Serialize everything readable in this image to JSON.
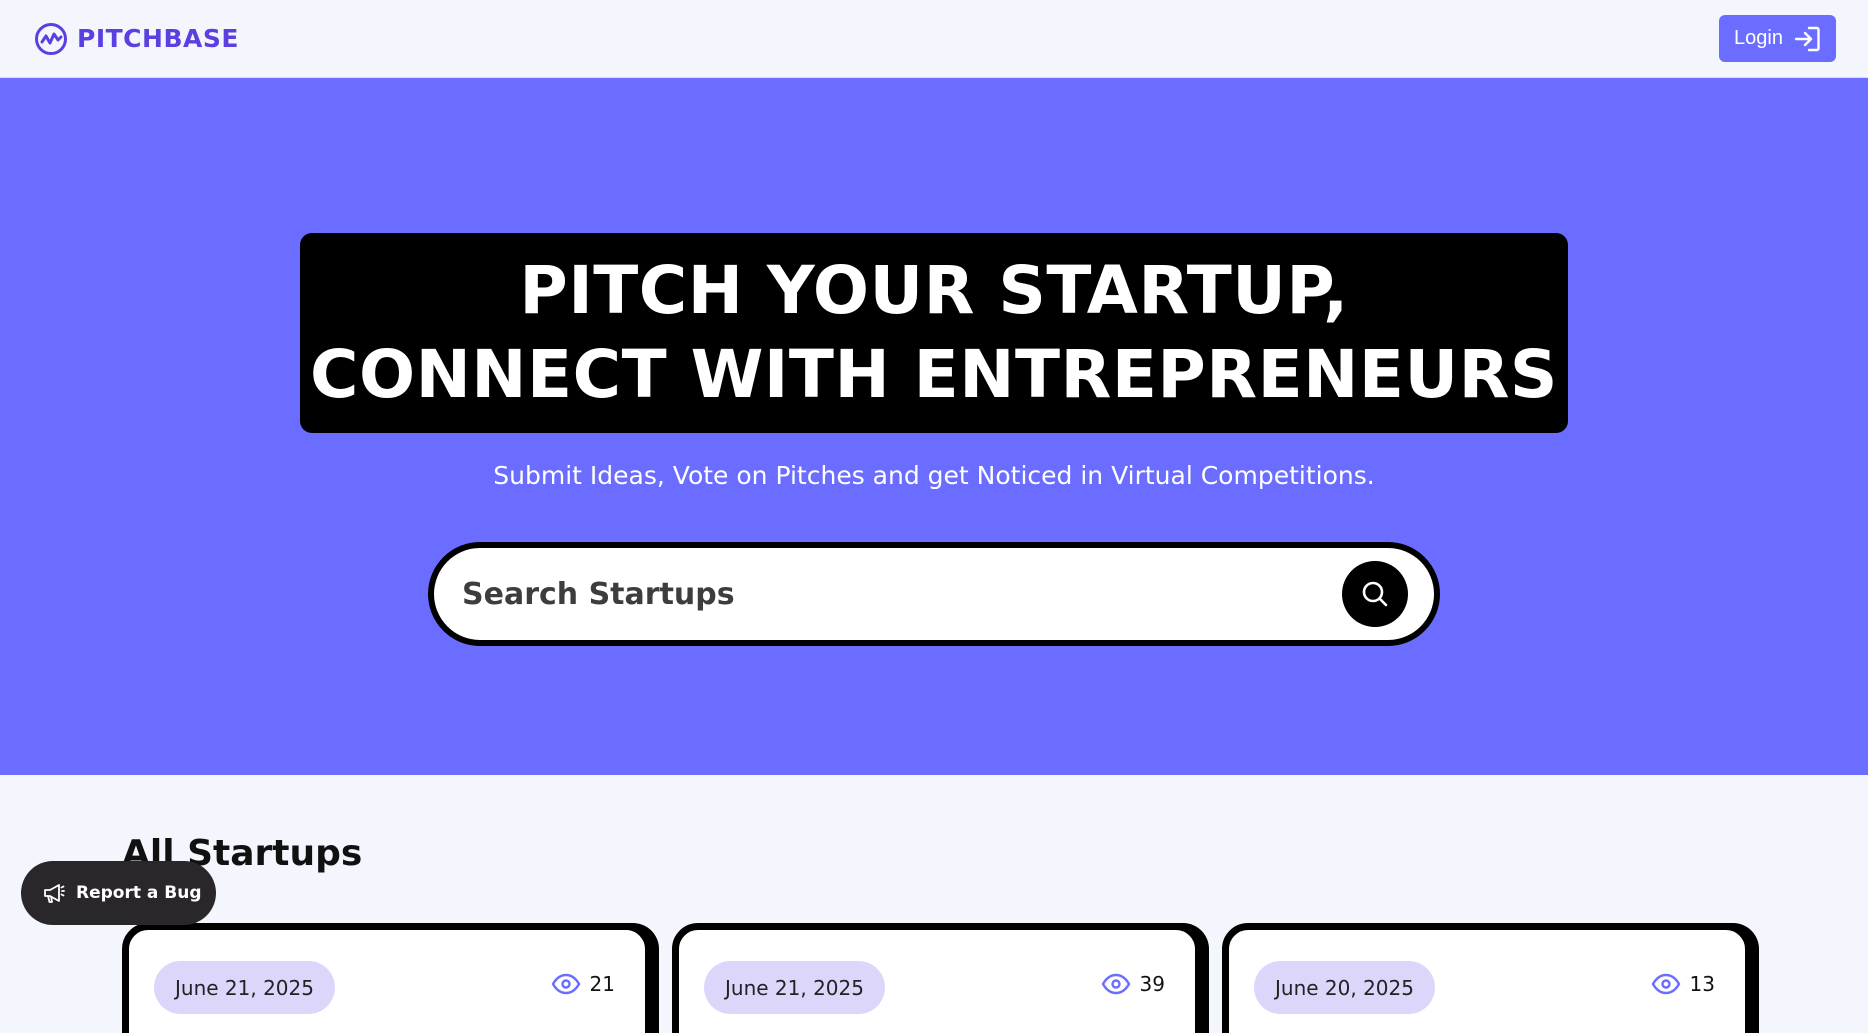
{
  "navbar": {
    "brand_name": "PITCHBASE",
    "login_label": "Login"
  },
  "hero": {
    "headline_line1": "PITCH YOUR STARTUP,",
    "headline_line2": "CONNECT WITH ENTREPRENEURS",
    "subtitle": "Submit Ideas, Vote on Pitches and get Noticed in Virtual Competitions.",
    "search_placeholder": "Search Startups"
  },
  "section": {
    "title": "All Startups"
  },
  "cards": [
    {
      "date": "June 21, 2025",
      "views": "21"
    },
    {
      "date": "June 21, 2025",
      "views": "39"
    },
    {
      "date": "June 20, 2025",
      "views": "13"
    }
  ],
  "floating": {
    "report_bug_label": "Report a Bug"
  },
  "colors": {
    "brand": "#5b3fe0",
    "hero_bg": "#6a6dff",
    "pill_bg": "#dcd6fb"
  }
}
